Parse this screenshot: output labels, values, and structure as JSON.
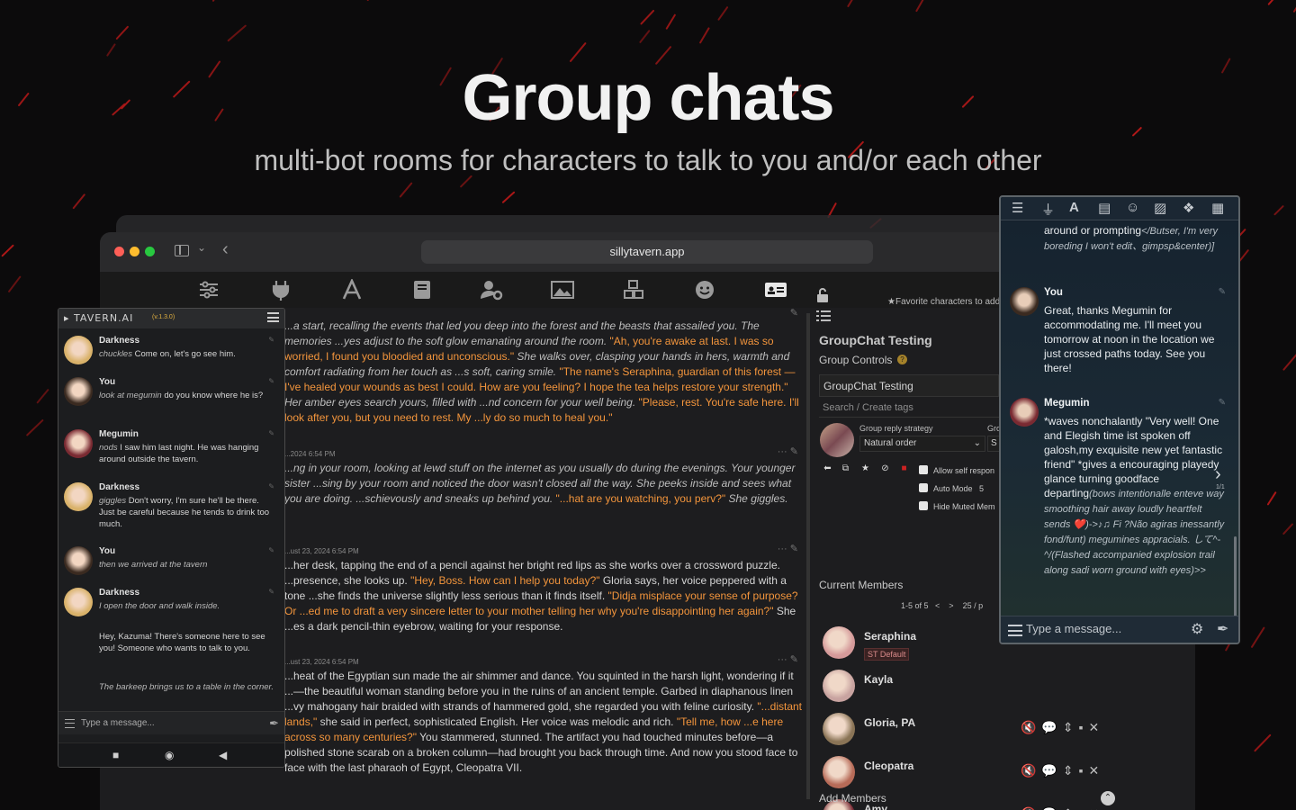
{
  "hero": {
    "title": "Group chats",
    "subtitle": "multi-bot rooms for characters to talk to you and/or each other"
  },
  "browser": {
    "url": "sillytavern.app",
    "top_icons": [
      "sliders-icon",
      "plug-icon",
      "font-icon",
      "book-icon",
      "user-gear-icon",
      "image-icon",
      "cubes-icon",
      "smile-icon",
      "id-card-icon"
    ]
  },
  "chat": {
    "messages": [
      {
        "date": "",
        "segments": [
          {
            "t": "...a start, recalling the events that led you deep into the forest and the beasts that assailed you. The memories ",
            "s": "it"
          },
          {
            "t": "...yes adjust to the soft glow emanating around the room. ",
            "s": "it"
          },
          {
            "t": "\"Ah, you're awake at last. I was so worried, I found you bloodied and unconscious.\"",
            "s": "q"
          },
          {
            "t": " She walks over, clasping your hands in hers, warmth and comfort radiating from her touch as ...s soft, caring smile. ",
            "s": "it"
          },
          {
            "t": "\"The name's Seraphina, guardian of this forest — I've healed your wounds as best I could. How are you feeling? I hope the tea helps restore your strength.\"",
            "s": "q"
          },
          {
            "t": " Her amber eyes search yours, filled with ...nd concern for your well being. ",
            "s": "it"
          },
          {
            "t": "\"Please, rest. You're safe here. I'll look after you, but you need to rest. My ...ly do so much to heal you.\"",
            "s": "q"
          }
        ]
      },
      {
        "date": "...2024 6:54 PM",
        "segments": [
          {
            "t": "...ng in your room, looking at lewd stuff on the internet as you usually do during the evenings. Your younger sister ...sing by your room and noticed the door wasn't closed all the way. She peeks inside and sees what you are doing. ...schievously and sneaks up behind you.",
            "s": "it"
          },
          {
            "t": " ",
            "s": "n"
          },
          {
            "t": "\"...hat are you watching, you perv?\"",
            "s": "q"
          },
          {
            "t": " She giggles.",
            "s": "it"
          }
        ]
      },
      {
        "date": "...ust 23, 2024 6:54 PM",
        "segments": [
          {
            "t": "...her desk, tapping the end of a pencil against her bright red lips as she works over a crossword puzzle. ...presence, she looks up. ",
            "s": "n"
          },
          {
            "t": "\"Hey, Boss. How can I help you today?\"",
            "s": "q"
          },
          {
            "t": " Gloria says, her voice peppered with a tone ...she finds the universe slightly less serious than it finds itself. ",
            "s": "n"
          },
          {
            "t": "\"Didja misplace your sense of purpose? Or ...ed me to draft a very sincere letter to your mother telling her why you're disappointing her again?\"",
            "s": "q"
          },
          {
            "t": " She ...es a dark pencil-thin eyebrow, waiting for your response.",
            "s": "n"
          }
        ]
      },
      {
        "date": "...ust 23, 2024 6:54 PM",
        "segments": [
          {
            "t": "...heat of the Egyptian sun made the air shimmer and dance. You squinted in the harsh light, wondering if it ...—the beautiful woman standing before you in the ruins of an ancient temple. Garbed in diaphanous linen ...vy mahogany hair braided with strands of hammered gold, she regarded you with feline curiosity.",
            "s": "n"
          },
          {
            "t": " ",
            "s": "n"
          },
          {
            "t": "\"...distant lands,\"",
            "s": "q"
          },
          {
            "t": " she said in perfect, sophisticated English. Her voice was melodic and rich. ",
            "s": "n"
          },
          {
            "t": "\"Tell me, how ...e here across so many centuries?\"",
            "s": "q"
          },
          {
            "t": " You stammered, stunned. The artifact you had touched minutes before—a polished stone scarab on a broken column—had brought you back through time. And now you stood face to face with the last pharaoh of Egypt, Cleopatra VII.",
            "s": "n"
          }
        ]
      }
    ]
  },
  "group": {
    "favorite_hint": "★Favorite characters to add",
    "title": "GroupChat Testing",
    "controls_label": "Group Controls",
    "help": "?",
    "name_value": "GroupChat Testing",
    "tags_placeholder": "Search / Create tags",
    "strategy_label": "Group reply strategy",
    "strategy_label2": "Gro",
    "strategy_value": "Natural order",
    "strategy_value2": "S",
    "allow_self": "Allow self respon",
    "auto_mode": "Auto Mode",
    "auto_mode_value": "5",
    "hide_muted": "Hide Muted Mem",
    "members_label": "Current Members",
    "pager": "1-5 of 5",
    "per_page": "25 / p",
    "members": [
      {
        "name": "Seraphina",
        "tag": "ST Default",
        "color": "#d59a9a"
      },
      {
        "name": "Kayla",
        "tag": "",
        "color": "#c8a3a0"
      },
      {
        "name": "Gloria, PA",
        "tag": "",
        "color": "#8a7456"
      },
      {
        "name": "Cleopatra",
        "tag": "",
        "color": "#b76b58"
      },
      {
        "name": "Amy",
        "tag": "",
        "color": "#7a2c36"
      }
    ],
    "add_members": "Add Members"
  },
  "mobile": {
    "brand": "TAVERN.AI",
    "version": "(v.1.3.0)",
    "messages": [
      {
        "name": "Darkness",
        "action": "chuckles",
        "text": " Come on, let's go see him.",
        "color": "#d9b26a"
      },
      {
        "name": "You",
        "action": "look at megumin",
        "text": " do you know where he is?",
        "color": "#3a2a20"
      },
      {
        "name": "Megumin",
        "action": "nods",
        "text": " I saw him last night. He was hanging around outside the tavern.",
        "color": "#7a2a32"
      },
      {
        "name": "Darkness",
        "action": "giggles",
        "text": " Don't worry, I'm sure he'll be there. Just be careful because he tends to drink too much.",
        "color": "#d9b26a"
      },
      {
        "name": "You",
        "action": "then we arrived at the tavern",
        "text": "",
        "color": "#3a2a20"
      },
      {
        "name": "Darkness",
        "action": "I open the door and walk inside.",
        "text": "",
        "color": "#d9b26a"
      },
      {
        "name": "",
        "action": "",
        "text": "Hey, Kazuma! There's someone here to see you! Someone who wants to talk to you.",
        "color": ""
      },
      {
        "name": "",
        "action": "The barkeep brings us to a table in the corner.",
        "text": "",
        "color": ""
      }
    ],
    "input_placeholder": "Type a message..."
  },
  "right_panel": {
    "top_text": "around or prompting",
    "top_it": "</Butser, I'm very boreding I won't edit、gimpsp&center)]",
    "messages": [
      {
        "name": "You",
        "text": "Great, thanks Megumin for accommodating me. I'll meet you tomorrow at noon in the location we just crossed paths today. See you there!",
        "color": "#3a2a20"
      },
      {
        "name": "Megumin",
        "text": "*waves nonchalantly \"Very well! One and Elegish time ist spoken off galosh,my exquisite new yet fantastic friend\" *gives a encouraging playedy glance turning goodface departing",
        "italic": "(bows intentionalle enteve way smoothing hair away loudly heartfelt sends ❤️)->♪♫ Fi ?Não agiras inessantly fond/funt) megumines appracials. して^-^/(Flashed accompanied explosion trail along sadi worn ground with eyes)>>",
        "color": "#7a2a32"
      }
    ],
    "swipe_count": "1/1",
    "input_placeholder": "Type a message..."
  },
  "colors": {
    "accent_quote": "#f3953c",
    "streak": "#b01818"
  }
}
